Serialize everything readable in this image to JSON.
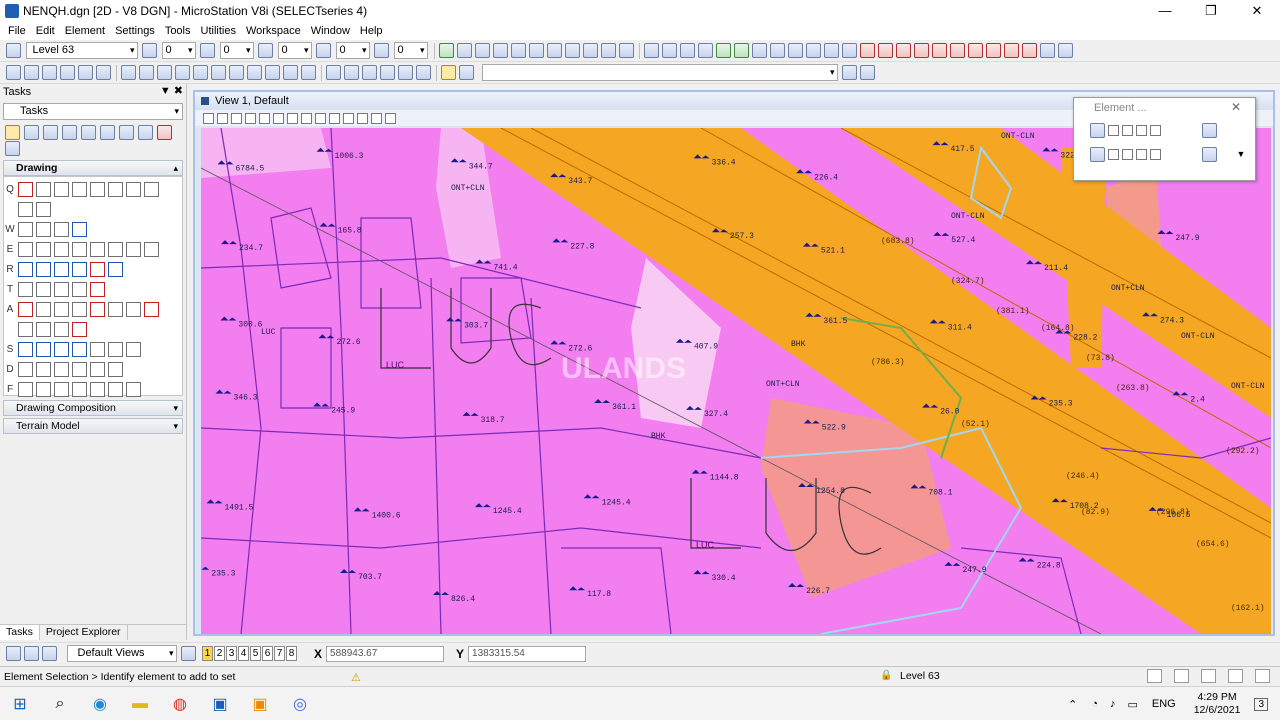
{
  "window": {
    "title": "NENQH.dgn [2D - V8 DGN] - MicroStation V8i (SELECTseries 4)",
    "minimize": "—",
    "maximize": "❐",
    "close": "✕"
  },
  "menu": [
    "File",
    "Edit",
    "Element",
    "Settings",
    "Tools",
    "Utilities",
    "Workspace",
    "Window",
    "Help"
  ],
  "attributes": {
    "level": "Level 63",
    "color": "0",
    "style": "0",
    "weight": "0",
    "transparency": "0",
    "priority": "0"
  },
  "tasks": {
    "title": "Tasks",
    "selected_task": "Tasks",
    "drawing_header": "Drawing",
    "row_letters": [
      "Q",
      "",
      "W",
      "E",
      "R",
      "T",
      "A",
      "",
      "S",
      "D",
      "F"
    ],
    "drawing_composition": "Drawing Composition",
    "terrain_model": "Terrain Model",
    "tab_tasks": "Tasks",
    "tab_project_explorer": "Project Explorer"
  },
  "view": {
    "title": "View 1, Default"
  },
  "element_dialog": {
    "title": "Element ..."
  },
  "map_labels": {
    "parcels": [
      "6784.5",
      "1006.3",
      "344.7",
      "343.7",
      "336.4",
      "226.4",
      "417.5",
      "322.6",
      "211.4",
      "234.7",
      "165.8",
      "741.4",
      "227.8",
      "257.3",
      "521.1",
      "527.4",
      "211.4",
      "247.9",
      "300.6",
      "272.6",
      "303.7",
      "272.6",
      "407.9",
      "361.5",
      "311.4",
      "228.2",
      "274.3",
      "346.3",
      "245.9",
      "318.7",
      "361.1",
      "327.4",
      "522.9",
      "26.0",
      "235.3",
      "2.4",
      "1491.5",
      "1400.6",
      "1245.4",
      "1245.4",
      "1144.8",
      "1254.8",
      "708.1",
      "1708.2",
      "106.5",
      "235.3",
      "703.7",
      "826.4",
      "117.8",
      "330.4",
      "226.7",
      "247.9",
      "224.8"
    ],
    "road_values": [
      "(683.8)",
      "(324.7)",
      "(381.1)",
      "(164.8)",
      "(786.3)",
      "(73.8)",
      "(263.8)",
      "(52.1)",
      "(246.4)",
      "(82.9)",
      "(296.8)",
      "(292.2)",
      "(654.6)",
      "(162.1)"
    ],
    "zones": [
      "LUC",
      "LUC"
    ],
    "codes": [
      "ONT-CLN",
      "ONT+CLN",
      "ONT-CLN",
      "ONT-CLN",
      "ONT+CLN",
      "ONT-CLN",
      "ONT-CLN",
      "BHK",
      "BHK",
      "LUC",
      "ONT+CLN"
    ],
    "watermark": "ULANDS"
  },
  "view_controls": {
    "views_label": "Default Views",
    "view_numbers": [
      "1",
      "2",
      "3",
      "4",
      "5",
      "6",
      "7",
      "8"
    ],
    "active_view": "1",
    "x_label": "X",
    "x_value": "588943.67",
    "y_label": "Y",
    "y_value": "1383315.54"
  },
  "status": {
    "prompt": "Element Selection > Identify element to add to set",
    "level": "Level 63"
  },
  "taskbar": {
    "language": "ENG",
    "time": "4:29 PM",
    "date": "12/6/2021",
    "notifications": "3"
  },
  "colors": {
    "parcel_fill": "#f27ef0",
    "road_fill": "#f5a623",
    "parcel_lines": "#7c2bb8"
  }
}
